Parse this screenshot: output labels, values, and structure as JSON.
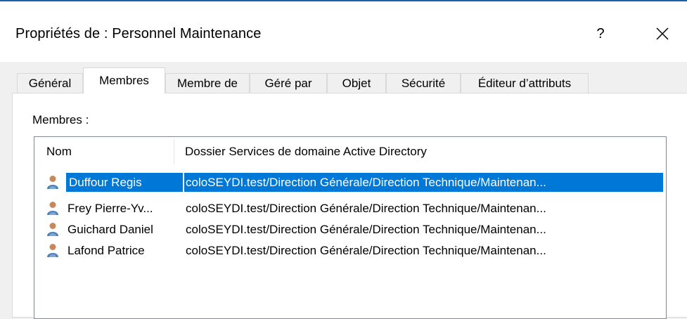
{
  "window": {
    "title": "Propriétés de : Personnel Maintenance",
    "help_label": "?",
    "close_icon": "close-icon"
  },
  "tabs": [
    {
      "label": "Général",
      "active": false
    },
    {
      "label": "Membres",
      "active": true
    },
    {
      "label": "Membre de",
      "active": false
    },
    {
      "label": "Géré par",
      "active": false
    },
    {
      "label": "Objet",
      "active": false
    },
    {
      "label": "Sécurité",
      "active": false
    },
    {
      "label": "Éditeur d’attributs",
      "active": false
    }
  ],
  "members": {
    "label": "Membres :",
    "columns": [
      "Nom",
      "Dossier Services de domaine Active Directory"
    ],
    "rows": [
      {
        "name": "Duffour Regis",
        "path": "coloSEYDI.test/Direction Générale/Direction Technique/Maintenan...",
        "selected": true,
        "icon": "user-icon"
      },
      {
        "name": "Frey Pierre-Yv...",
        "path": "coloSEYDI.test/Direction Générale/Direction Technique/Maintenan...",
        "selected": false,
        "icon": "user-icon"
      },
      {
        "name": "Guichard Daniel",
        "path": "coloSEYDI.test/Direction Générale/Direction Technique/Maintenan...",
        "selected": false,
        "icon": "user-icon"
      },
      {
        "name": "Lafond Patrice",
        "path": "coloSEYDI.test/Direction Générale/Direction Technique/Maintenan...",
        "selected": false,
        "icon": "user-icon"
      }
    ]
  },
  "colors": {
    "selection": "#0078d7",
    "title_accent": "#1f5fa8"
  }
}
